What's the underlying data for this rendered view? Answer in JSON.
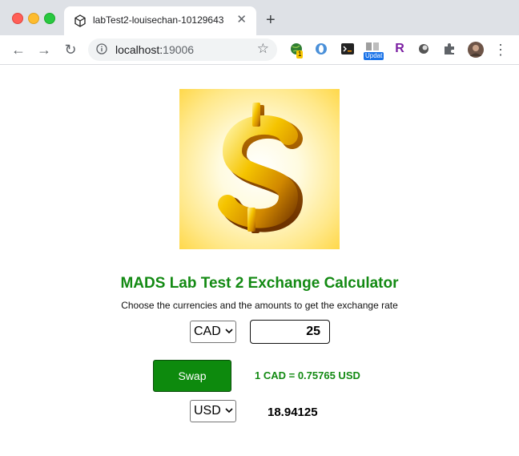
{
  "browser": {
    "tab_title": "labTest2-louisechan-10129643",
    "new_tab_label": "+",
    "url_host": "localhost:",
    "url_port": "19006",
    "extensions": [
      {
        "name": "globe-extension-icon",
        "badge": "1"
      },
      {
        "name": "opera-extension-icon"
      },
      {
        "name": "terminal-extension-icon"
      },
      {
        "name": "update-extension-icon",
        "badge": "Updat"
      },
      {
        "name": "r-extension-icon",
        "glyph": "R"
      },
      {
        "name": "circle-extension-icon"
      },
      {
        "name": "puzzle-extension-icon"
      },
      {
        "name": "profile-avatar"
      }
    ]
  },
  "app": {
    "heading": "MADS Lab Test 2 Exchange Calculator",
    "subtitle": "Choose the currencies and the amounts to get the exchange rate",
    "from_currency": "CAD",
    "amount": "25",
    "swap_label": "Swap",
    "rate_text": "1 CAD = 0.75765 USD",
    "to_currency": "USD",
    "result": "18.94125",
    "colors": {
      "accent": "#138a13",
      "button_bg": "#0d8a0d"
    }
  }
}
